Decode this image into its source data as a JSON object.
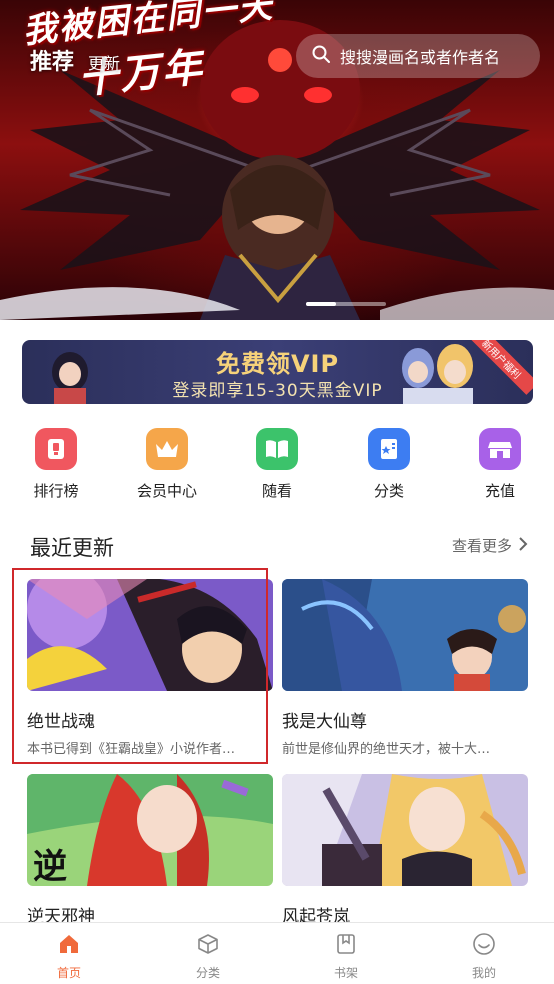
{
  "hero": {
    "art_title": "我被困在同一天",
    "art_title_big": "十万年",
    "tab_active": "推荐",
    "tab_other": "更新",
    "search_placeholder": "搜搜漫画名或者作者名"
  },
  "vip_banner": {
    "title": "免费领VIP",
    "subtitle": "登录即享15-30天黑金VIP",
    "ribbon": "新用户福利"
  },
  "shortcuts": [
    {
      "label": "排行榜",
      "icon": "ranking-icon",
      "color": "#f0575f"
    },
    {
      "label": "会员中心",
      "icon": "crown-icon",
      "color": "#f5a64a"
    },
    {
      "label": "随看",
      "icon": "book-open-icon",
      "color": "#3cc36b"
    },
    {
      "label": "分类",
      "icon": "category-book-icon",
      "color": "#3d7df2"
    },
    {
      "label": "充值",
      "icon": "shop-icon",
      "color": "#a861e8"
    }
  ],
  "recent": {
    "title": "最近更新",
    "more": "查看更多",
    "cards": [
      {
        "title": "绝世战魂",
        "desc": "本书已得到《狂霸战皇》小说作者…"
      },
      {
        "title": "我是大仙尊",
        "desc": "前世是修仙界的绝世天才，被十大…"
      },
      {
        "title": "逆天邪神",
        "desc": "",
        "cover_text": "逆"
      },
      {
        "title": "风起苍岚",
        "desc": ""
      }
    ]
  },
  "nav": [
    {
      "label": "首页",
      "icon": "home-icon",
      "active": true
    },
    {
      "label": "分类",
      "icon": "cube-icon",
      "active": false
    },
    {
      "label": "书架",
      "icon": "bookshelf-icon",
      "active": false
    },
    {
      "label": "我的",
      "icon": "profile-smile-icon",
      "active": false
    }
  ],
  "colors": {
    "accent": "#f06a3b",
    "highlight_border": "#d0282b"
  }
}
